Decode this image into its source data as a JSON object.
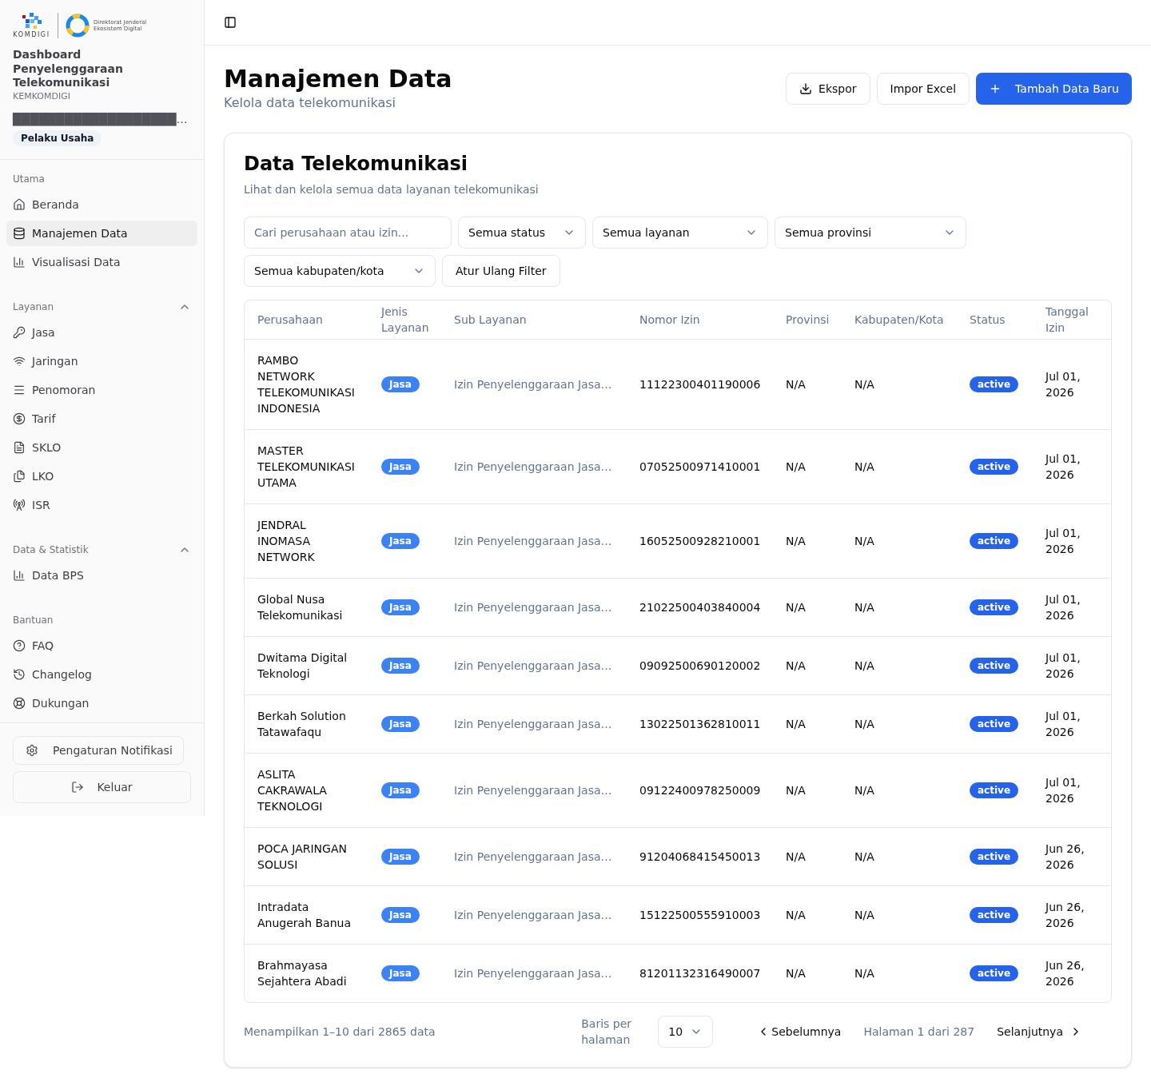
{
  "sidebar": {
    "logo": {
      "wordmark": "KOMDIGI",
      "caption_lines": [
        "Direktorat Jenderal",
        "Ekosistem Digital"
      ]
    },
    "app_title": "Dashboard Penyelenggaraan Telekomunikasi",
    "organization": "KEMKOMDIGI",
    "user_name": "███████████████████…",
    "role_badge": "Pelaku Usaha",
    "sections": [
      {
        "label": "Utama",
        "collapsible": false,
        "items": [
          {
            "label": "Beranda",
            "selected": false
          },
          {
            "label": "Manajemen Data",
            "selected": true
          },
          {
            "label": "Visualisasi Data",
            "selected": false
          }
        ]
      },
      {
        "label": "Layanan",
        "collapsible": true,
        "expanded": true,
        "items": [
          {
            "label": "Jasa",
            "selected": false
          },
          {
            "label": "Jaringan",
            "selected": false
          },
          {
            "label": "Penomoran",
            "selected": false
          },
          {
            "label": "Tarif",
            "selected": false
          },
          {
            "label": "SKLO",
            "selected": false
          },
          {
            "label": "LKO",
            "selected": false
          },
          {
            "label": "ISR",
            "selected": false
          }
        ]
      },
      {
        "label": "Data & Statistik",
        "collapsible": true,
        "expanded": true,
        "items": [
          {
            "label": "Data BPS",
            "selected": false
          }
        ]
      },
      {
        "label": "Bantuan",
        "collapsible": false,
        "items": [
          {
            "label": "FAQ",
            "selected": false
          },
          {
            "label": "Changelog",
            "selected": false
          },
          {
            "label": "Dukungan",
            "selected": false
          }
        ]
      }
    ],
    "footer_buttons": [
      {
        "label": "Pengaturan Notifikasi",
        "kind": "compact"
      },
      {
        "label": "Keluar",
        "kind": "wide"
      }
    ]
  },
  "page": {
    "title": "Manajemen Data",
    "subtitle": "Kelola data telekomunikasi",
    "actions": [
      {
        "label": "Ekspor",
        "kind": "outline"
      },
      {
        "label": "Impor Excel",
        "kind": "outline"
      },
      {
        "label": "Tambah Data Baru",
        "kind": "primary"
      }
    ]
  },
  "data_card": {
    "title": "Data Telekomunikasi",
    "subtitle": "Lihat dan kelola semua data layanan telekomunikasi",
    "filters": [
      {
        "kind": "search",
        "placeholder": "Cari perusahaan atau izin..."
      },
      {
        "kind": "select",
        "value": "Semua status"
      },
      {
        "kind": "select",
        "value": "Semua layanan"
      },
      {
        "kind": "select",
        "value": "Semua provinsi"
      },
      {
        "kind": "select",
        "value": "Semua kabupaten/kota"
      },
      {
        "kind": "button",
        "label": "Atur Ulang Filter"
      }
    ],
    "table": {
      "columns": [
        "Perusahaan",
        "Jenis Layanan",
        "Sub Layanan",
        "Nomor Izin",
        "Provinsi",
        "Kabupaten/Kota",
        "Status",
        "Tanggal Izin"
      ],
      "rows": [
        {
          "company": "RAMBO NETWORK TELEKOMUNIKASI INDONESIA",
          "service_type": "Jasa",
          "sub_service": "Izin Penyelenggaraan Jasa…",
          "license_number": "11122300401190006",
          "province": "N/A",
          "city": "N/A",
          "status": "active",
          "date": "Jul 01, 2026"
        },
        {
          "company": "MASTER TELEKOMUNIKASI UTAMA",
          "service_type": "Jasa",
          "sub_service": "Izin Penyelenggaraan Jasa…",
          "license_number": "07052500971410001",
          "province": "N/A",
          "city": "N/A",
          "status": "active",
          "date": "Jul 01, 2026"
        },
        {
          "company": "JENDRAL INOMASA NETWORK",
          "service_type": "Jasa",
          "sub_service": "Izin Penyelenggaraan Jasa…",
          "license_number": "16052500928210001",
          "province": "N/A",
          "city": "N/A",
          "status": "active",
          "date": "Jul 01, 2026"
        },
        {
          "company": "Global Nusa Telekomunikasi",
          "service_type": "Jasa",
          "sub_service": "Izin Penyelenggaraan Jasa…",
          "license_number": "21022500403840004",
          "province": "N/A",
          "city": "N/A",
          "status": "active",
          "date": "Jul 01, 2026"
        },
        {
          "company": "Dwitama Digital Teknologi",
          "service_type": "Jasa",
          "sub_service": "Izin Penyelenggaraan Jasa…",
          "license_number": "09092500690120002",
          "province": "N/A",
          "city": "N/A",
          "status": "active",
          "date": "Jul 01, 2026"
        },
        {
          "company": "Berkah Solution Tatawafaqu",
          "service_type": "Jasa",
          "sub_service": "Izin Penyelenggaraan Jasa…",
          "license_number": "13022501362810011",
          "province": "N/A",
          "city": "N/A",
          "status": "active",
          "date": "Jul 01, 2026"
        },
        {
          "company": "ASLITA CAKRAWALA TEKNOLOGI",
          "service_type": "Jasa",
          "sub_service": "Izin Penyelenggaraan Jasa…",
          "license_number": "09122400978250009",
          "province": "N/A",
          "city": "N/A",
          "status": "active",
          "date": "Jul 01, 2026"
        },
        {
          "company": "POCA JARINGAN SOLUSI",
          "service_type": "Jasa",
          "sub_service": "Izin Penyelenggaraan Jasa…",
          "license_number": "91204068415450013",
          "province": "N/A",
          "city": "N/A",
          "status": "active",
          "date": "Jun 26, 2026"
        },
        {
          "company": "Intradata Anugerah Banua",
          "service_type": "Jasa",
          "sub_service": "Izin Penyelenggaraan Jasa…",
          "license_number": "15122500555910003",
          "province": "N/A",
          "city": "N/A",
          "status": "active",
          "date": "Jun 26, 2026"
        },
        {
          "company": "Brahmayasa Sejahtera Abadi",
          "service_type": "Jasa",
          "sub_service": "Izin Penyelenggaraan Jasa…",
          "license_number": "81201132316490007",
          "province": "N/A",
          "city": "N/A",
          "status": "active",
          "date": "Jun 26, 2026"
        }
      ]
    },
    "pagination": {
      "summary": "Menampilkan 1–10 dari 2865 data",
      "rows_per_page_label": "Baris per halaman",
      "rows_per_page": "10",
      "previous": "Sebelumnya",
      "page_info": "Halaman 1 dari 287",
      "next": "Selanjutnya"
    }
  }
}
